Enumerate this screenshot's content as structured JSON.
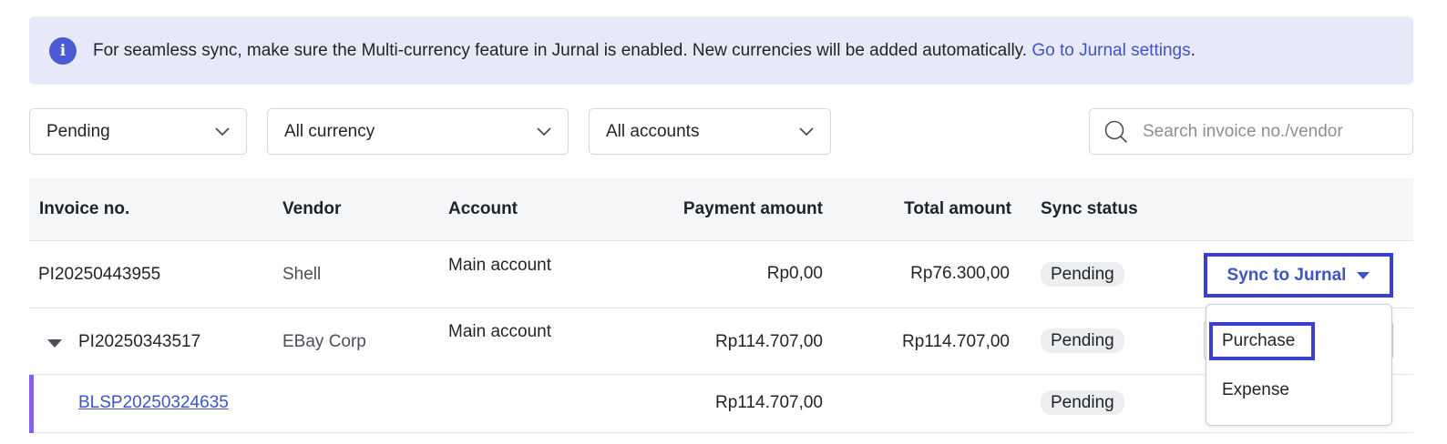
{
  "banner": {
    "icon": "info-icon",
    "message": "For seamless sync, make sure the Multi-currency feature in Jurnal is enabled. New currencies will be added automatically.",
    "link_text": "Go to Jurnal settings",
    "trailing": "."
  },
  "filters": {
    "status": "Pending",
    "currency": "All currency",
    "accounts": "All accounts"
  },
  "search": {
    "placeholder": "Search invoice no./vendor"
  },
  "table": {
    "headers": {
      "invoice": "Invoice no.",
      "vendor": "Vendor",
      "account": "Account",
      "payment": "Payment amount",
      "total": "Total amount",
      "sync": "Sync status"
    },
    "rows": [
      {
        "invoice": "PI20250443955",
        "vendor": "Shell",
        "account": "Main account",
        "payment": "Rp0,00",
        "total": "Rp76.300,00",
        "status": "Pending"
      },
      {
        "invoice": "PI20250343517",
        "vendor": "EBay Corp",
        "account": "Main account",
        "payment": "Rp114.707,00",
        "total": "Rp114.707,00",
        "status": "Pending"
      }
    ],
    "child_rows": [
      {
        "invoice": "BLSP20250324635",
        "payment": "Rp114.707,00",
        "status": "Pending"
      }
    ]
  },
  "sync_button": {
    "label": "Sync to Jurnal"
  },
  "sync_menu": {
    "items": [
      "Purchase",
      "Expense"
    ]
  },
  "colors": {
    "accent": "#3f55c7",
    "focus_ring": "#3b3fcf",
    "banner_bg": "#e7e8f8",
    "child_bar": "#8a5cf6"
  }
}
